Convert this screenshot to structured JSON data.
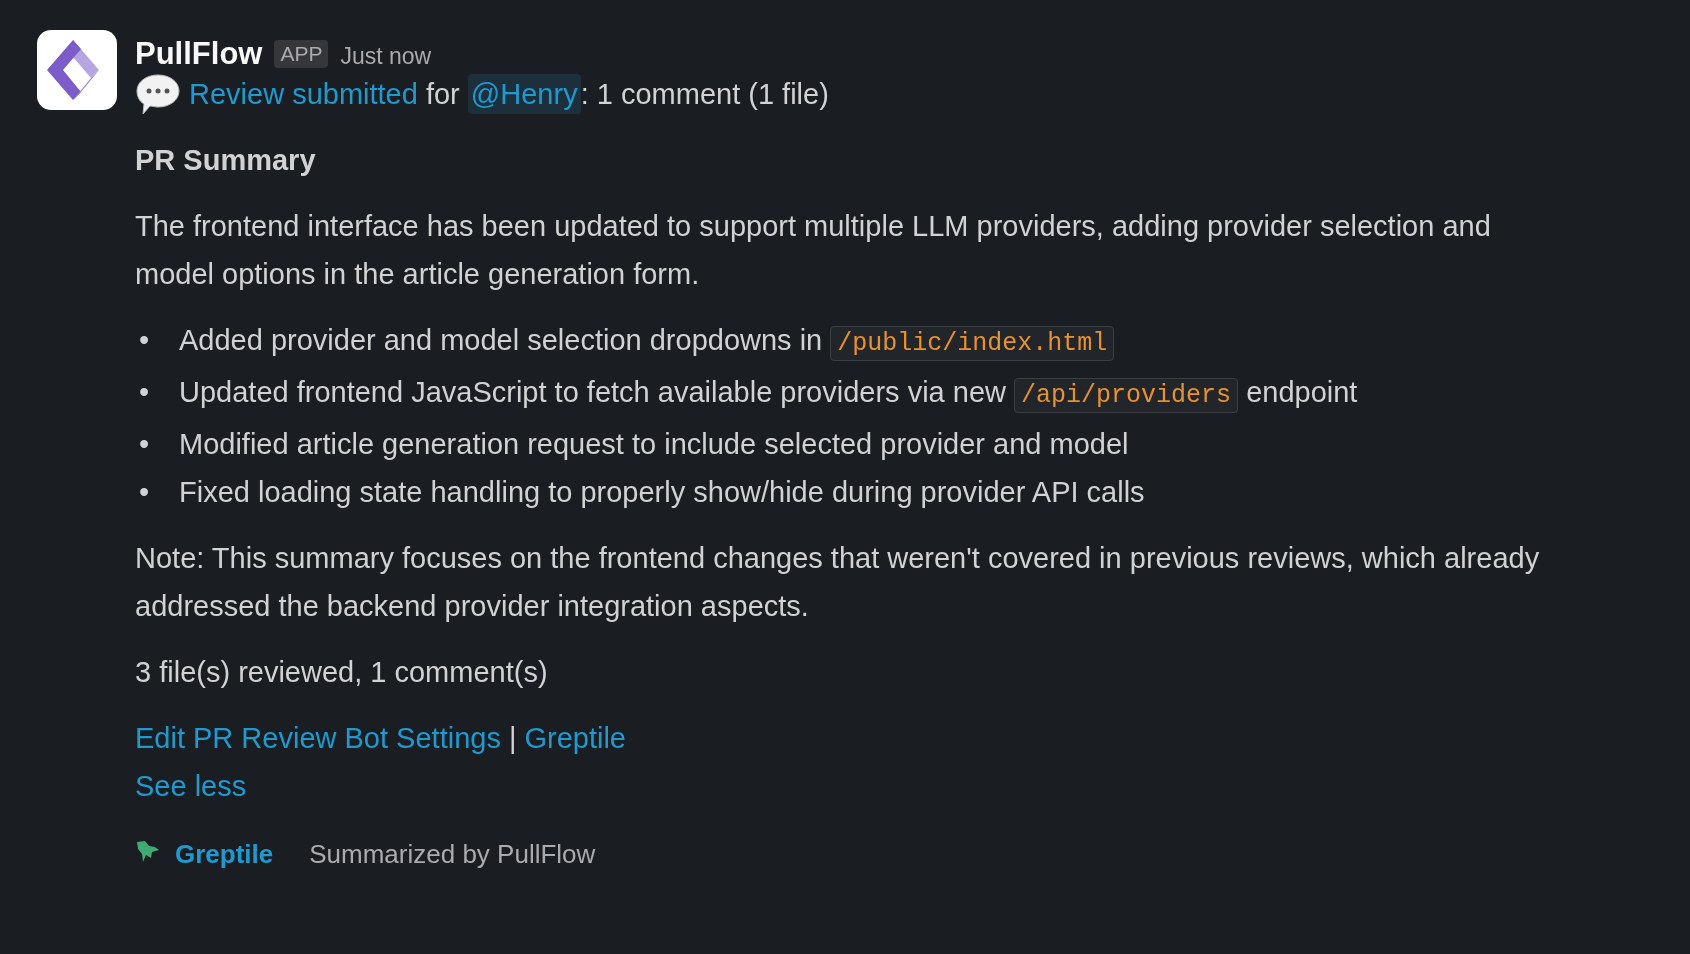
{
  "message": {
    "sender": "PullFlow",
    "badge": "APP",
    "time": "Just now",
    "headline": [
      {
        "kind": "link",
        "text": "Review submitted"
      },
      {
        "kind": "text",
        "text": " for "
      },
      {
        "kind": "mention",
        "text": "@Henry"
      },
      {
        "kind": "text",
        "text": ": 1 comment (1 file)"
      }
    ],
    "heading": "PR Summary",
    "paragraph": "The frontend interface has been updated to support multiple LLM providers, adding provider selection and model options in the article generation form.",
    "bullets": [
      {
        "marker": "•",
        "parts": [
          {
            "kind": "text",
            "text": "Added provider and model selection dropdowns in "
          },
          {
            "kind": "code",
            "text": "/public/index.html"
          }
        ]
      },
      {
        "marker": "•",
        "parts": [
          {
            "kind": "text",
            "text": "Updated frontend JavaScript to fetch available providers via new "
          },
          {
            "kind": "code",
            "text": "/api/providers"
          },
          {
            "kind": "text",
            "text": " endpoint"
          }
        ]
      },
      {
        "marker": "•",
        "parts": [
          {
            "kind": "text",
            "text": "Modified article generation request to include selected provider and model"
          }
        ]
      },
      {
        "marker": "•",
        "parts": [
          {
            "kind": "text",
            "text": "Fixed loading state handling to properly show/hide during provider API calls"
          }
        ]
      }
    ],
    "note": "Note: This summary focuses on the frontend changes that weren't covered in previous reviews, which already addressed the backend provider integration aspects.",
    "stats": "3 file(s) reviewed, 1 comment(s)",
    "links": [
      {
        "kind": "link",
        "text": "Edit PR Review Bot Settings"
      },
      {
        "kind": "separator",
        "text": "|"
      },
      {
        "kind": "link",
        "text": "Greptile"
      }
    ],
    "see_less": "See less",
    "footer": {
      "app": "Greptile",
      "note": "Summarized by PullFlow"
    }
  }
}
